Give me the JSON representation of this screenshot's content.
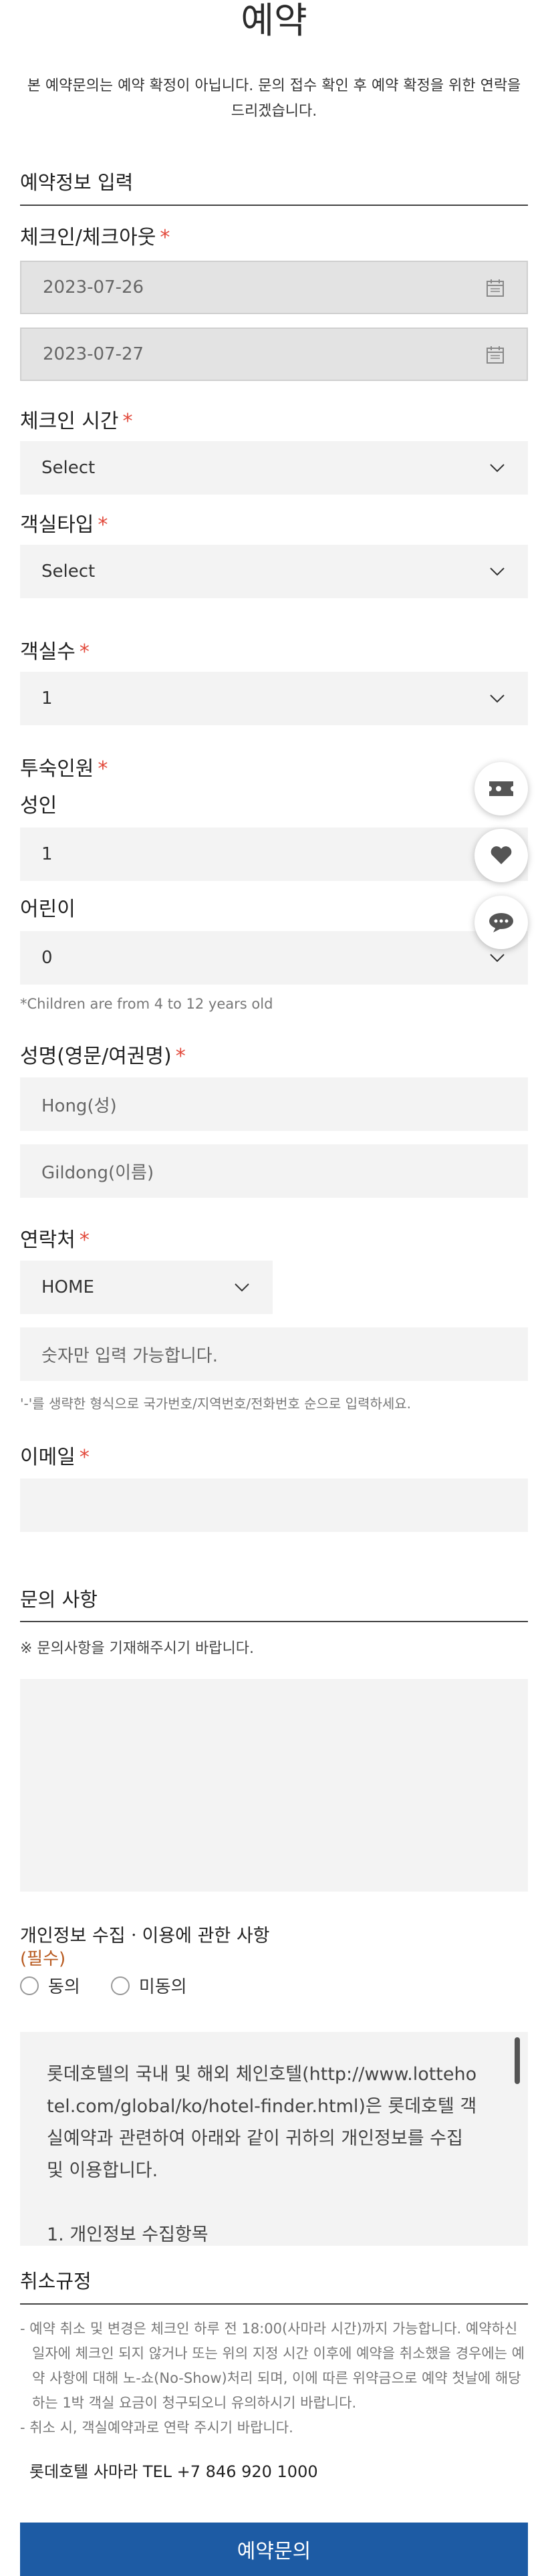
{
  "header": {
    "title": "예약"
  },
  "notice": "본 예약문의는 예약 확정이 아닙니다. 문의 접수 확인 후 예약 확정을 위한 연락을 드리겠습니다.",
  "reservation": {
    "section_title": "예약정보 입력",
    "checkin_checkout_label": "체크인/체크아웃",
    "checkin_date": "2023-07-26",
    "checkout_date": "2023-07-27",
    "checkin_time_label": "체크인 시간",
    "checkin_time_value": "Select",
    "room_type_label": "객실타입",
    "room_type_value": "Select",
    "room_count_label": "객실수",
    "room_count_value": "1",
    "guests_label": "투숙인원",
    "adults_label": "성인",
    "adults_value": "1",
    "children_label": "어린이",
    "children_value": "0",
    "children_note": "*Children are from 4 to 12 years old",
    "name_label": "성명(영문/여권명)",
    "last_name_placeholder": "Hong(성)",
    "first_name_placeholder": "Gildong(이름)",
    "phone_label": "연락처",
    "phone_type_value": "HOME",
    "phone_placeholder": "숫자만 입력 가능합니다.",
    "phone_note": "'-'를 생략한 형식으로 국가번호/지역번호/전화번호 순으로 입력하세요.",
    "email_label": "이메일",
    "required_mark": "*"
  },
  "inquiry": {
    "section_title": "문의 사항",
    "note": "※ 문의사항을 기재해주시기 바랍니다."
  },
  "privacy": {
    "title": "개인정보 수집ㆍ이용에 관한 사항",
    "required": "(필수)",
    "agree": "동의",
    "disagree": "미동의",
    "text": "롯데호텔의 국내 및 해외 체인호텔(http://www.lottehotel.com/global/ko/hotel-finder.html)은 롯데호텔 객실예약과 관련하여 아래와 같이 귀하의 개인정보를 수집 및 이용합니다.",
    "item1": "1. 개인정보 수집항목"
  },
  "cancellation": {
    "title": "취소규정",
    "items": [
      "- 예약 취소 및 변경은 체크인 하루 전 18:00(사마라 시간)까지 가능합니다. 예약하신 일자에 체크인 되지 않거나 또는 위의 지정 시간 이후에 예약을 취소했을 경우에는 예약 사항에 대해 노-쇼(No-Show)처리 되며, 이에 따른 위약금으로 예약 첫날에 해당하는 1박 객실 요금이 청구되오니 유의하시기 바랍니다.",
      "- 취소 시, 객실예약과로 연락 주시기 바랍니다."
    ],
    "contact": "롯데호텔 사마라 TEL +7 846 920 1000"
  },
  "submit_label": "예약문의",
  "floating": {
    "icons": [
      "ticket-icon",
      "heart-icon",
      "chat-icon"
    ]
  },
  "colors": {
    "required": "#e2493b",
    "submit": "#1d5ba4"
  }
}
